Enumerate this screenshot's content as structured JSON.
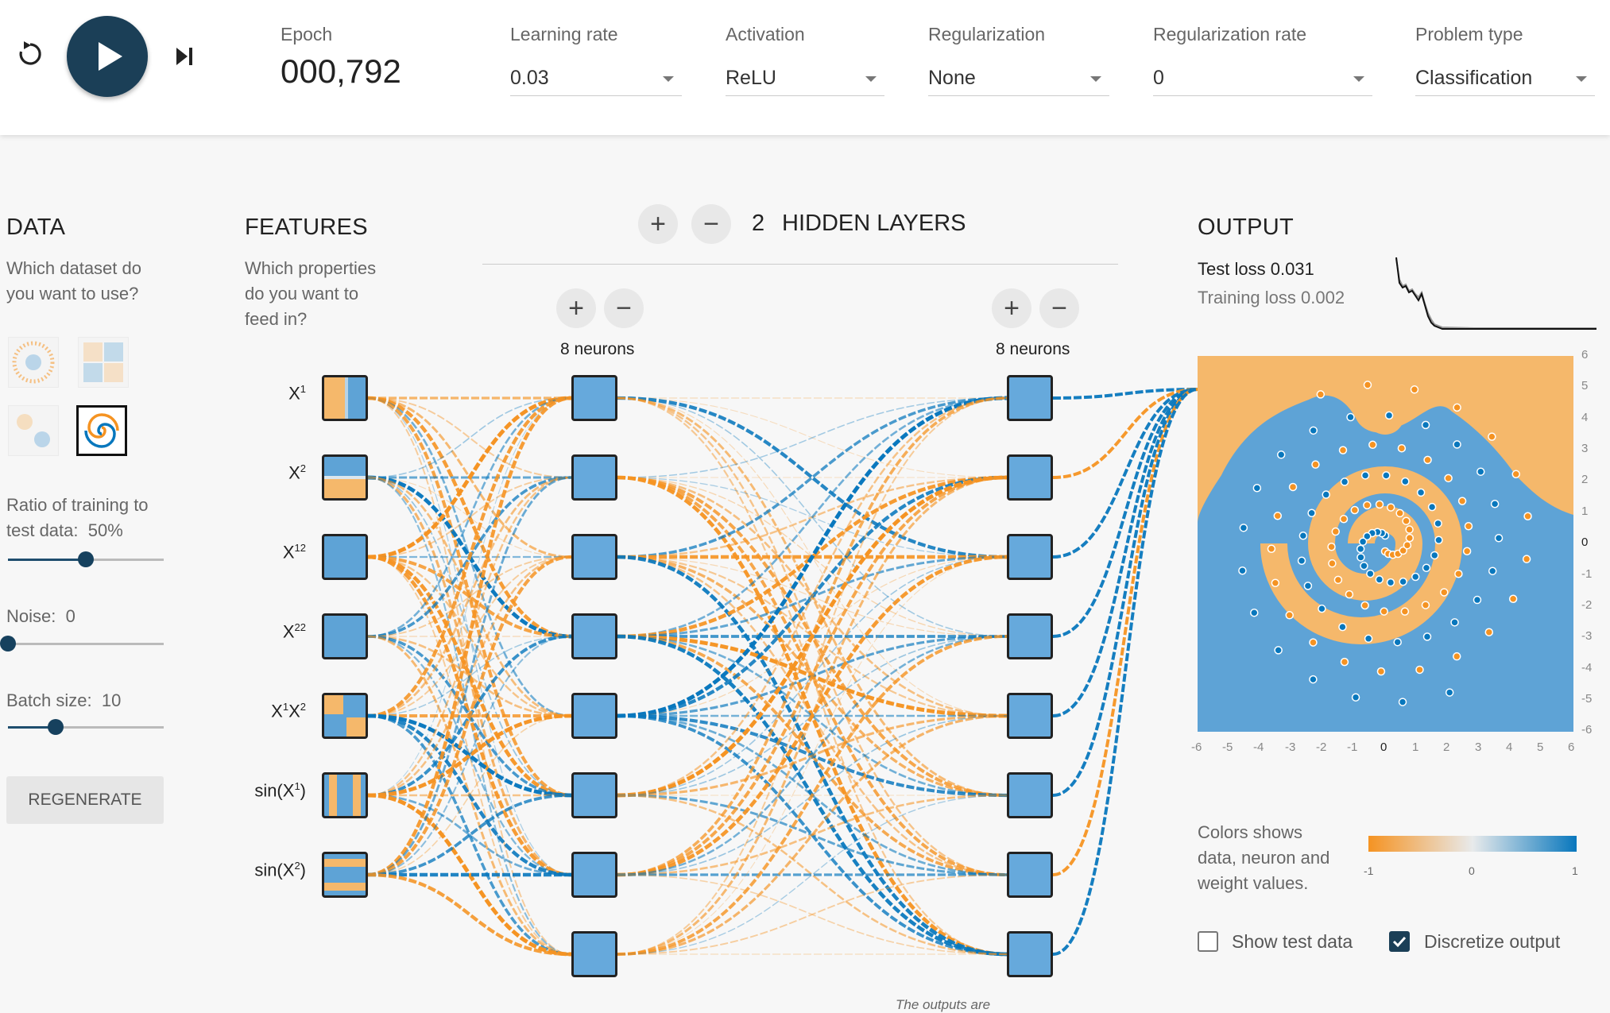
{
  "topbar": {
    "epoch_label": "Epoch",
    "epoch_value": "000,792",
    "learning_rate_label": "Learning rate",
    "learning_rate_value": "0.03",
    "activation_label": "Activation",
    "activation_value": "ReLU",
    "regularization_label": "Regularization",
    "regularization_value": "None",
    "reg_rate_label": "Regularization rate",
    "reg_rate_value": "0",
    "problem_type_label": "Problem type",
    "problem_type_value": "Classification",
    "icons": {
      "reset": "reset-icon",
      "play": "play-icon",
      "step": "step-icon"
    }
  },
  "data": {
    "title": "DATA",
    "help_line1": "Which dataset do",
    "help_line2": "you want to use?",
    "datasets": [
      "circle",
      "xor",
      "gaussian",
      "spiral"
    ],
    "selected_dataset": "spiral",
    "ratio_label": "Ratio of training to",
    "ratio_label2": "test data:",
    "ratio_value": "50%",
    "ratio_fraction": 0.5,
    "noise_label": "Noise:",
    "noise_value": "0",
    "noise_fraction": 0.0,
    "batch_label": "Batch size:",
    "batch_value": "10",
    "batch_fraction": 0.32,
    "regenerate_label": "REGENERATE"
  },
  "features": {
    "title": "FEATURES",
    "help_line1": "Which properties",
    "help_line2": "do you want to",
    "help_line3": "feed in?",
    "items": [
      {
        "base": "X",
        "sup": "1",
        "tail": ""
      },
      {
        "base": "X",
        "sup": "2",
        "tail": ""
      },
      {
        "base": "X",
        "sup": "12",
        "tail": ""
      },
      {
        "base": "X",
        "sup": "22",
        "tail": ""
      },
      {
        "base": "X",
        "sup": "1",
        "tail": "X",
        "sup2": "2"
      },
      {
        "base": "sin(X",
        "sup": "1",
        "tail": ")"
      },
      {
        "base": "sin(X",
        "sup": "2",
        "tail": ")"
      }
    ]
  },
  "network": {
    "hidden_count": "2",
    "hidden_label": "HIDDEN LAYERS",
    "layer1_neurons": "8 neurons",
    "layer2_neurons": "8 neurons",
    "plus_symbol": "+",
    "minus_symbol": "−",
    "note": "The outputs are"
  },
  "output": {
    "title": "OUTPUT",
    "test_loss_label": "Test loss",
    "test_loss_value": "0.031",
    "training_loss_label": "Training loss",
    "training_loss_value": "0.002",
    "x_ticks": [
      "-6",
      "-5",
      "-4",
      "-3",
      "-2",
      "-1",
      "0",
      "1",
      "2",
      "3",
      "4",
      "5",
      "6"
    ],
    "y_ticks": [
      "6",
      "5",
      "4",
      "3",
      "2",
      "1",
      "0",
      "-1",
      "-2",
      "-3",
      "-4",
      "-5",
      "-6"
    ],
    "legend_text1": "Colors shows",
    "legend_text2": "data, neuron and",
    "legend_text3": "weight values.",
    "legend_ticks": [
      "-1",
      "0",
      "1"
    ],
    "show_test_label": "Show test data",
    "show_test_checked": false,
    "discretize_label": "Discretize output",
    "discretize_checked": true
  },
  "colors": {
    "orange": "#f59322",
    "blue": "#0877bd",
    "light_orange": "#f5b86b",
    "light_blue": "#5ba3d6",
    "dark_button": "#1b3f57"
  }
}
